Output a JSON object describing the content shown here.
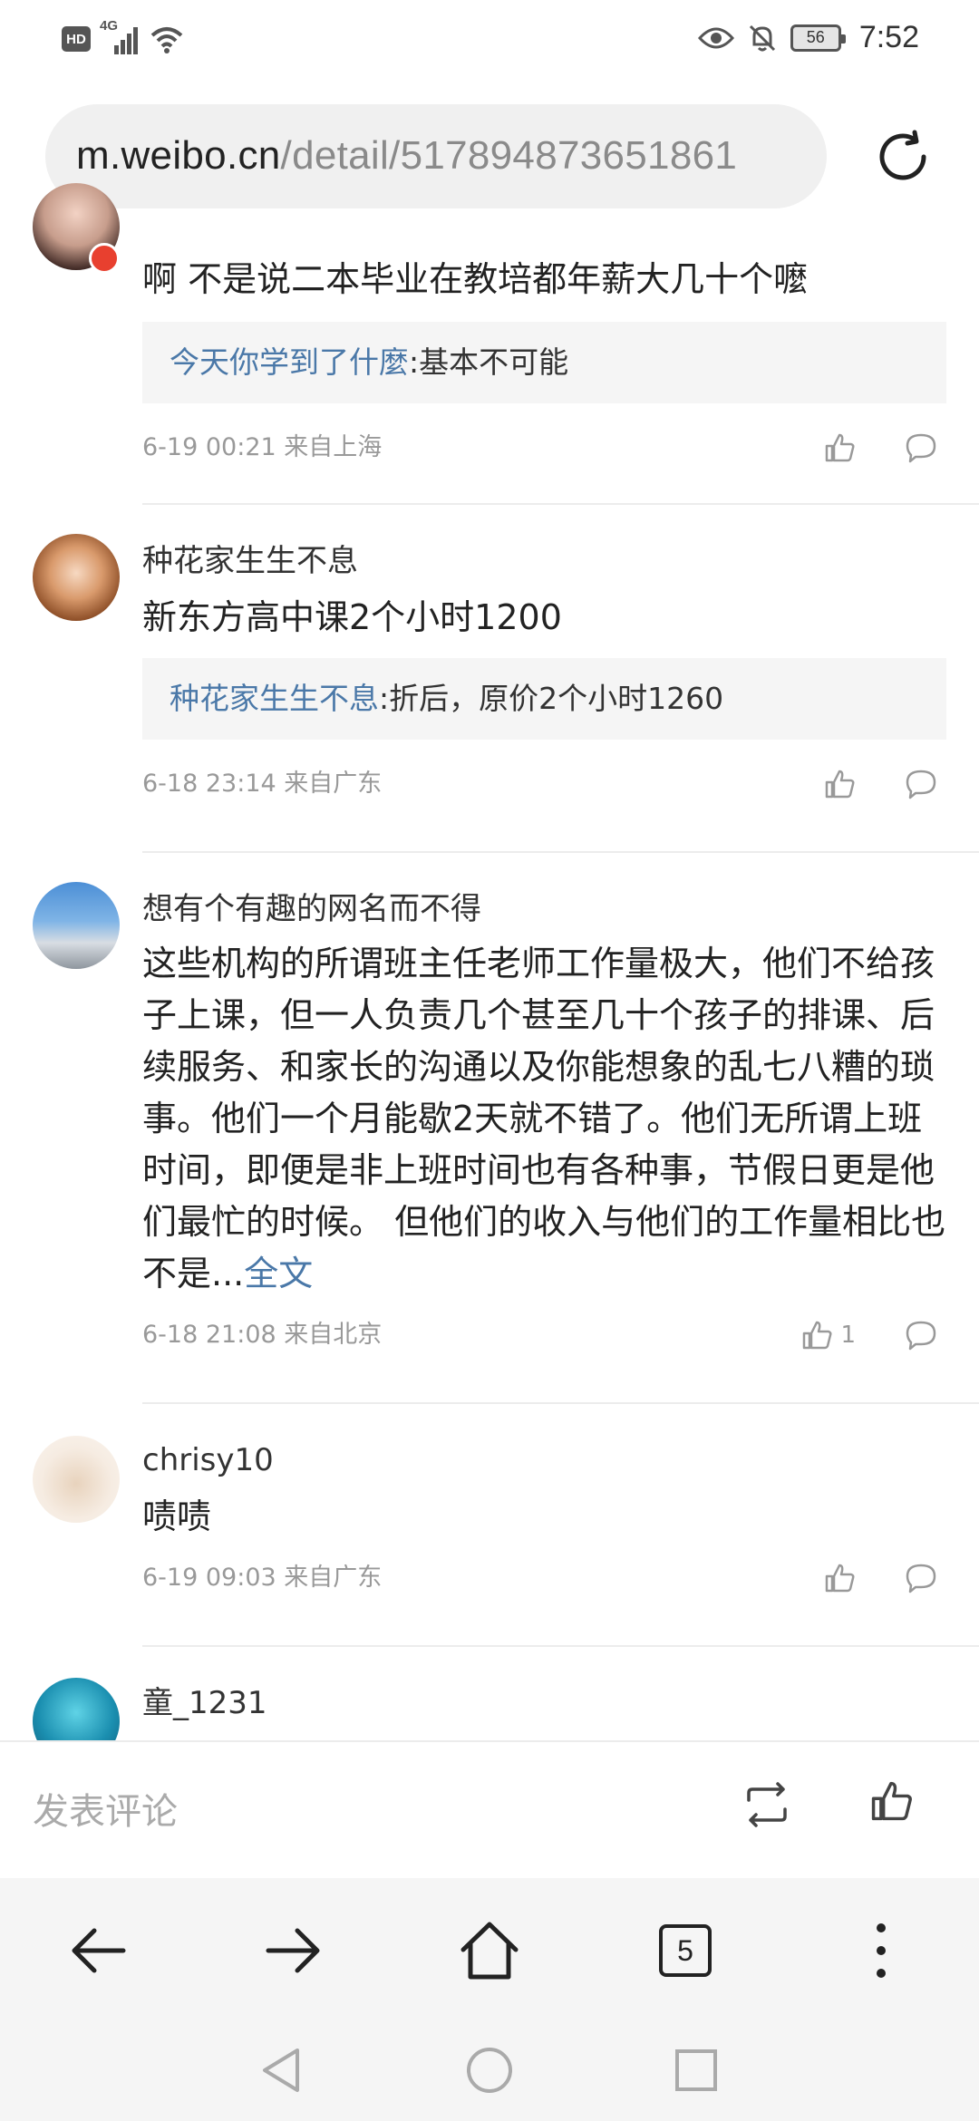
{
  "status_bar": {
    "network_badge": "HD",
    "network_type": "4G",
    "battery": "56",
    "time": "7:52"
  },
  "url_bar": {
    "domain": "m.weibo.cn",
    "path": "/detail/517894873651861"
  },
  "comments": [
    {
      "text": "啊 不是说二本毕业在教培都年薪大几十个嚒",
      "reply_user": "今天你学到了什麼",
      "reply_text": ":基本不可能",
      "meta": "6-19 00:21 来自上海",
      "likes": ""
    },
    {
      "name": "种花家生生不息",
      "text": "新东方高中课2个小时1200",
      "reply_user": "种花家生生不息",
      "reply_text": ":折后，原价2个小时1260",
      "meta": "6-18 23:14 来自广东",
      "likes": ""
    },
    {
      "name": "想有个有趣的网名而不得",
      "text": "这些机构的所谓班主任老师工作量极大，他们不给孩子上课，但一人负责几个甚至几十个孩子的排课、后续服务、和家长的沟通以及你能想象的乱七八糟的琐事。他们一个月能歇2天就不错了。他们无所谓上班时间，即便是非上班时间也有各种事，节假日更是他们最忙的时候。 但他们的收入与他们的工作量相比也不是...",
      "more": "全文",
      "meta": "6-18 21:08 来自北京",
      "likes": "1"
    },
    {
      "name": "chrisy10",
      "text": "啧啧",
      "meta": "6-19 09:03 来自广东",
      "likes": ""
    },
    {
      "name": "童_1231"
    }
  ],
  "comment_bar": {
    "placeholder": "发表评论"
  },
  "browser_nav": {
    "tab_count": "5"
  },
  "colors": {
    "link": "#4a78a8",
    "meta": "#999999",
    "reply_bg": "#f5f5f5"
  }
}
